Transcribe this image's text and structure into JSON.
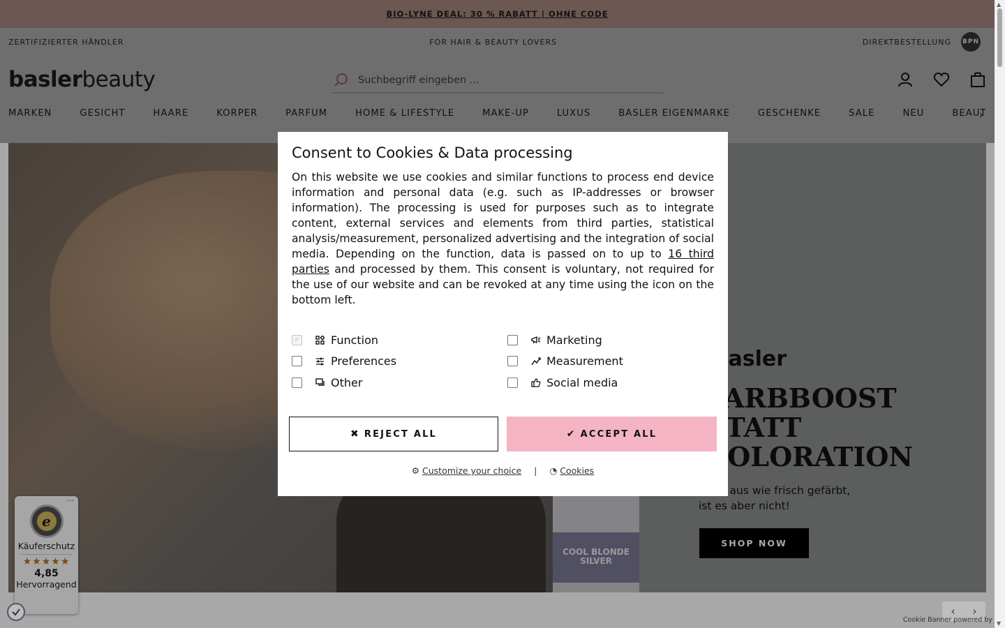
{
  "promo": {
    "text": "BIO-LYNE DEAL: 30 % RABATT | OHNE CODE"
  },
  "info_bar": {
    "left": "ZERTIFIZIERTER HÄNDLER",
    "center": "FOR HAIR & BEAUTY LOVERS",
    "right": "DIREKTBESTELLUNG",
    "bpn_logo": "BPN"
  },
  "header": {
    "logo_bold": "basler",
    "logo_regular": "beauty",
    "search_placeholder": "Suchbegriff eingeben ...",
    "icons": [
      "user-icon",
      "heart-icon",
      "bag-icon"
    ]
  },
  "nav": {
    "items": [
      "MARKEN",
      "GESICHT",
      "HAARE",
      "KÖRPER",
      "PARFUM",
      "HOME & LIFESTYLE",
      "MAKE-UP",
      "LUXUS",
      "BASLER EIGENMARKE",
      "GESCHENKE",
      "SALE",
      "NEU",
      "BEAUTY TRENDS"
    ]
  },
  "hero": {
    "brand": "basler",
    "headline_lines": [
      "FARBBOOST",
      "STATT",
      "COLORATION"
    ],
    "sub_lines": [
      "Sieht aus wie frisch gefärbt,",
      "ist es aber nicht!"
    ],
    "cta": "SHOP NOW",
    "bottle_label_lines": [
      "COOL BLONDE",
      "SILVER"
    ]
  },
  "consent": {
    "title": "Consent to Cookies & Data processing",
    "body_before_link": "On this website we use cookies and similar functions to process end device information and personal data (e.g. such as IP-addresses or browser information). The processing is used for purposes such as to integrate content, external services and elements from third parties, statistical analysis/measurement, personalized advertising and the integration of social media. Depending on the function, data is passed on to up to ",
    "body_link": "16 third parties",
    "body_after_link": " and processed by them. This consent is voluntary, not required for the use of our website and can be revoked at any time using the icon on the bottom left.",
    "options": [
      {
        "label": "Function",
        "checked": true,
        "disabled": true,
        "icon": "grid-icon"
      },
      {
        "label": "Marketing",
        "checked": false,
        "disabled": false,
        "icon": "megaphone-icon"
      },
      {
        "label": "Preferences",
        "checked": false,
        "disabled": false,
        "icon": "sliders-icon"
      },
      {
        "label": "Measurement",
        "checked": false,
        "disabled": false,
        "icon": "chart-line-icon"
      },
      {
        "label": "Other",
        "checked": false,
        "disabled": false,
        "icon": "chat-icon"
      },
      {
        "label": "Social media",
        "checked": false,
        "disabled": false,
        "icon": "thumbs-up-icon"
      }
    ],
    "reject_label": "REJECT ALL",
    "accept_label": "ACCEPT ALL",
    "customize_label": "Customize your choice",
    "separator": "|",
    "cookies_label": "Cookies",
    "accept_color": "#f4b4c4"
  },
  "trusted_shops": {
    "label": "Käuferschutz",
    "stars": "★★★★★",
    "score": "4,85",
    "rating": "Hervorragend",
    "menu": "···"
  },
  "footer": {
    "powered_by": "Cookie Banner powered by"
  }
}
